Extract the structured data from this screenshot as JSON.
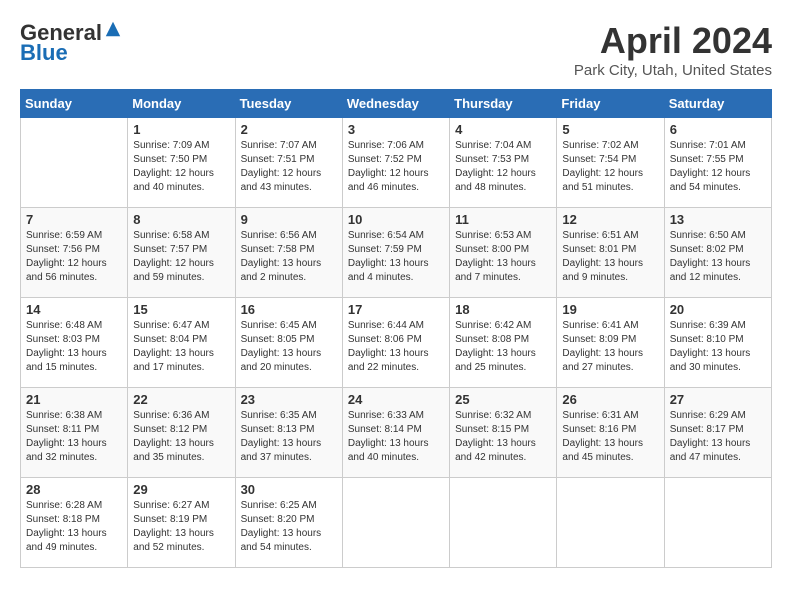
{
  "header": {
    "logo_general": "General",
    "logo_blue": "Blue",
    "title": "April 2024",
    "location": "Park City, Utah, United States"
  },
  "days_of_week": [
    "Sunday",
    "Monday",
    "Tuesday",
    "Wednesday",
    "Thursday",
    "Friday",
    "Saturday"
  ],
  "weeks": [
    [
      {
        "day": "",
        "info": ""
      },
      {
        "day": "1",
        "info": "Sunrise: 7:09 AM\nSunset: 7:50 PM\nDaylight: 12 hours\nand 40 minutes."
      },
      {
        "day": "2",
        "info": "Sunrise: 7:07 AM\nSunset: 7:51 PM\nDaylight: 12 hours\nand 43 minutes."
      },
      {
        "day": "3",
        "info": "Sunrise: 7:06 AM\nSunset: 7:52 PM\nDaylight: 12 hours\nand 46 minutes."
      },
      {
        "day": "4",
        "info": "Sunrise: 7:04 AM\nSunset: 7:53 PM\nDaylight: 12 hours\nand 48 minutes."
      },
      {
        "day": "5",
        "info": "Sunrise: 7:02 AM\nSunset: 7:54 PM\nDaylight: 12 hours\nand 51 minutes."
      },
      {
        "day": "6",
        "info": "Sunrise: 7:01 AM\nSunset: 7:55 PM\nDaylight: 12 hours\nand 54 minutes."
      }
    ],
    [
      {
        "day": "7",
        "info": "Sunrise: 6:59 AM\nSunset: 7:56 PM\nDaylight: 12 hours\nand 56 minutes."
      },
      {
        "day": "8",
        "info": "Sunrise: 6:58 AM\nSunset: 7:57 PM\nDaylight: 12 hours\nand 59 minutes."
      },
      {
        "day": "9",
        "info": "Sunrise: 6:56 AM\nSunset: 7:58 PM\nDaylight: 13 hours\nand 2 minutes."
      },
      {
        "day": "10",
        "info": "Sunrise: 6:54 AM\nSunset: 7:59 PM\nDaylight: 13 hours\nand 4 minutes."
      },
      {
        "day": "11",
        "info": "Sunrise: 6:53 AM\nSunset: 8:00 PM\nDaylight: 13 hours\nand 7 minutes."
      },
      {
        "day": "12",
        "info": "Sunrise: 6:51 AM\nSunset: 8:01 PM\nDaylight: 13 hours\nand 9 minutes."
      },
      {
        "day": "13",
        "info": "Sunrise: 6:50 AM\nSunset: 8:02 PM\nDaylight: 13 hours\nand 12 minutes."
      }
    ],
    [
      {
        "day": "14",
        "info": "Sunrise: 6:48 AM\nSunset: 8:03 PM\nDaylight: 13 hours\nand 15 minutes."
      },
      {
        "day": "15",
        "info": "Sunrise: 6:47 AM\nSunset: 8:04 PM\nDaylight: 13 hours\nand 17 minutes."
      },
      {
        "day": "16",
        "info": "Sunrise: 6:45 AM\nSunset: 8:05 PM\nDaylight: 13 hours\nand 20 minutes."
      },
      {
        "day": "17",
        "info": "Sunrise: 6:44 AM\nSunset: 8:06 PM\nDaylight: 13 hours\nand 22 minutes."
      },
      {
        "day": "18",
        "info": "Sunrise: 6:42 AM\nSunset: 8:08 PM\nDaylight: 13 hours\nand 25 minutes."
      },
      {
        "day": "19",
        "info": "Sunrise: 6:41 AM\nSunset: 8:09 PM\nDaylight: 13 hours\nand 27 minutes."
      },
      {
        "day": "20",
        "info": "Sunrise: 6:39 AM\nSunset: 8:10 PM\nDaylight: 13 hours\nand 30 minutes."
      }
    ],
    [
      {
        "day": "21",
        "info": "Sunrise: 6:38 AM\nSunset: 8:11 PM\nDaylight: 13 hours\nand 32 minutes."
      },
      {
        "day": "22",
        "info": "Sunrise: 6:36 AM\nSunset: 8:12 PM\nDaylight: 13 hours\nand 35 minutes."
      },
      {
        "day": "23",
        "info": "Sunrise: 6:35 AM\nSunset: 8:13 PM\nDaylight: 13 hours\nand 37 minutes."
      },
      {
        "day": "24",
        "info": "Sunrise: 6:33 AM\nSunset: 8:14 PM\nDaylight: 13 hours\nand 40 minutes."
      },
      {
        "day": "25",
        "info": "Sunrise: 6:32 AM\nSunset: 8:15 PM\nDaylight: 13 hours\nand 42 minutes."
      },
      {
        "day": "26",
        "info": "Sunrise: 6:31 AM\nSunset: 8:16 PM\nDaylight: 13 hours\nand 45 minutes."
      },
      {
        "day": "27",
        "info": "Sunrise: 6:29 AM\nSunset: 8:17 PM\nDaylight: 13 hours\nand 47 minutes."
      }
    ],
    [
      {
        "day": "28",
        "info": "Sunrise: 6:28 AM\nSunset: 8:18 PM\nDaylight: 13 hours\nand 49 minutes."
      },
      {
        "day": "29",
        "info": "Sunrise: 6:27 AM\nSunset: 8:19 PM\nDaylight: 13 hours\nand 52 minutes."
      },
      {
        "day": "30",
        "info": "Sunrise: 6:25 AM\nSunset: 8:20 PM\nDaylight: 13 hours\nand 54 minutes."
      },
      {
        "day": "",
        "info": ""
      },
      {
        "day": "",
        "info": ""
      },
      {
        "day": "",
        "info": ""
      },
      {
        "day": "",
        "info": ""
      }
    ]
  ]
}
